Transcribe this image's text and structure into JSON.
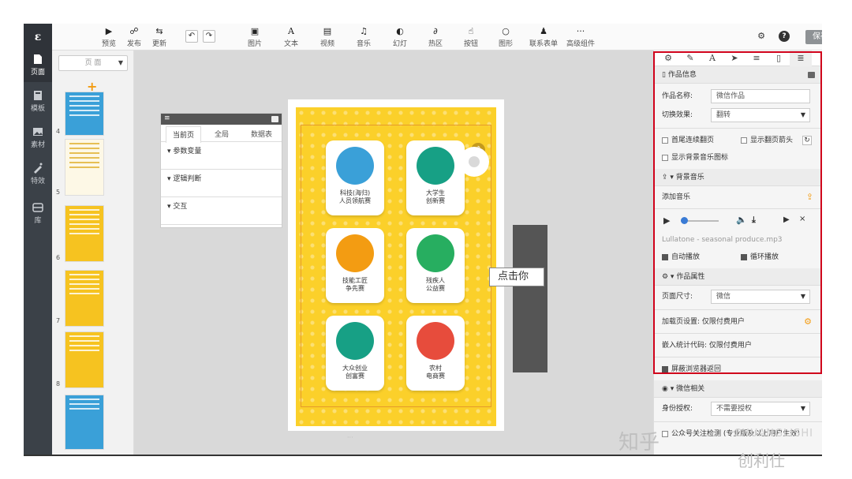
{
  "app": {
    "logo": "ε"
  },
  "leftnav": [
    {
      "label": "页面",
      "icon": "page-icon",
      "active": true
    },
    {
      "label": "模板",
      "icon": "template-icon",
      "active": false
    },
    {
      "label": "素材",
      "icon": "image-icon",
      "active": false
    },
    {
      "label": "特效",
      "icon": "magic-icon",
      "active": false
    },
    {
      "label": "库",
      "icon": "library-icon",
      "active": false
    }
  ],
  "toolbar": {
    "preview": "预览",
    "publish": "发布",
    "update": "更新",
    "image": "图片",
    "text": "文本",
    "video": "视频",
    "music": "音乐",
    "slide": "幻灯",
    "hotspot": "热区",
    "button": "按钮",
    "shape": "图形",
    "form": "联系表单",
    "advanced": "高级组件",
    "advanced_icon": "···",
    "save": "保存"
  },
  "pages": {
    "selector": "页 面",
    "numbers": [
      "4",
      "5",
      "6",
      "7",
      "8"
    ]
  },
  "state_panel": {
    "tabs": [
      "当前页",
      "全局",
      "数据表"
    ],
    "rows": [
      "▾ 参数变量",
      "▾ 逻辑判断",
      "▾ 交互"
    ]
  },
  "phone": {
    "cards": [
      {
        "line1": "科技(海归)",
        "line2": "人员领航赛",
        "color": "#3aa0d8",
        "icon": "atom-icon"
      },
      {
        "line1": "大学生",
        "line2": "创新赛",
        "color": "#17a085",
        "icon": "graduation-cap-icon"
      },
      {
        "line1": "技能工匠",
        "line2": "争先赛",
        "color": "#f39c12",
        "icon": "worker-icon"
      },
      {
        "line1": "残疾人",
        "line2": "公益赛",
        "color": "#27ae60",
        "icon": "wheelchair-icon"
      },
      {
        "line1": "大众创业",
        "line2": "创富赛",
        "color": "#17a085",
        "icon": "people-icon"
      },
      {
        "line1": "农村",
        "line2": "电商赛",
        "color": "#e74c3c",
        "icon": "ecommerce-icon"
      }
    ]
  },
  "canvas": {
    "click_hint": "点击你",
    "size_label": "···"
  },
  "right": {
    "tabs": [
      "gear-icon",
      "brush-icon",
      "font-icon",
      "send-icon",
      "list-icon",
      "doc-icon",
      "database-icon"
    ],
    "work_info": "作品信息",
    "work_name_label": "作品名称:",
    "work_name_value": "微信作品",
    "transition_label": "切换效果:",
    "transition_value": "翻转",
    "loop_label": "首尾连续翻页",
    "arrow_label": "显示翻页箭头",
    "bg_icon_label": "显示背景音乐图标",
    "bg_music": "背景音乐",
    "add_music": "添加音乐",
    "track": "Lullatone - seasonal produce.mp3",
    "autoplay": "自动播放",
    "loop_play": "循环播放",
    "work_props": "作品属性",
    "page_size_label": "页面尺寸:",
    "page_size_value": "微信",
    "loading_label": "加载页设置: 仅限付费用户",
    "embed_label": "嵌入统计代码: 仅限付费用户",
    "block_back": "屏蔽浏览器返回",
    "wechat": "微信相关",
    "auth_label": "身份授权:",
    "auth_value": "不需要授权",
    "follow_label": "公众号关注检测 (专业版及以上用户生效)"
  },
  "watermark": {
    "zhihu": "知乎",
    "brand_en": "CHUANGLISHI",
    "brand_cn": "创利仕"
  }
}
